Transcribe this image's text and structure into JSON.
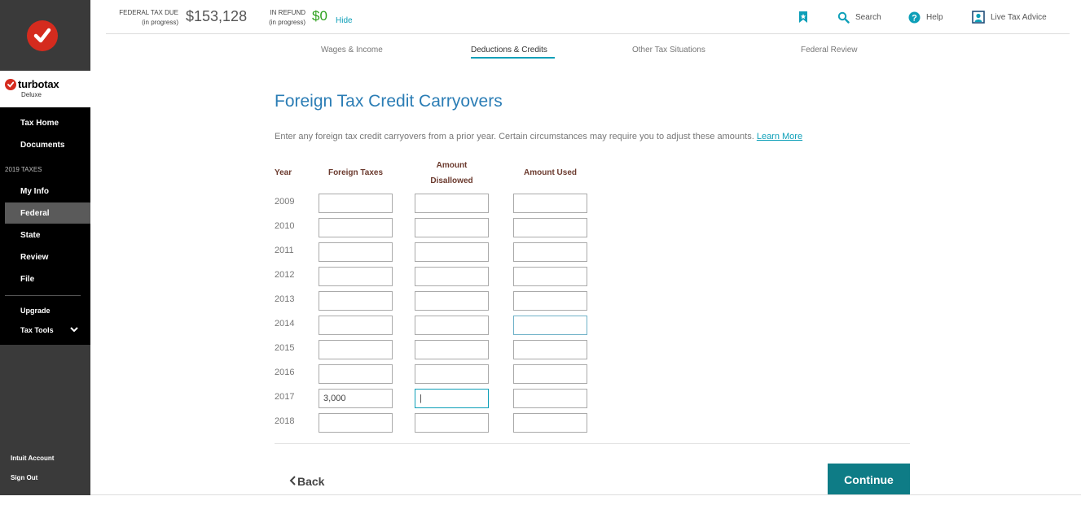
{
  "app": {
    "brand": "turbotax",
    "edition": "Deluxe"
  },
  "header": {
    "federal_label_1": "FEDERAL TAX DUE",
    "federal_label_2": "(in progress)",
    "federal_amount": "$153,128",
    "refund_label_1": "IN REFUND",
    "refund_label_2": "(in progress)",
    "refund_amount": "$0",
    "hide_label": "Hide",
    "search_label": "Search",
    "help_label": "Help",
    "live_label": "Live Tax Advice"
  },
  "sidebar": {
    "tax_home": "Tax Home",
    "documents": "Documents",
    "section_label": "2019 TAXES",
    "my_info": "My Info",
    "federal": "Federal",
    "state": "State",
    "review": "Review",
    "file": "File",
    "upgrade": "Upgrade",
    "tax_tools": "Tax Tools",
    "intuit_account": "Intuit Account",
    "sign_out": "Sign Out"
  },
  "tabs": [
    "Wages & Income",
    "Deductions & Credits",
    "Other Tax Situations",
    "Federal Review"
  ],
  "main": {
    "title": "Foreign Tax Credit Carryovers",
    "intro": "Enter any foreign tax credit carryovers from a prior year. Certain circumstances may require you to adjust these amounts.",
    "learn_more": "Learn More",
    "col_year": "Year",
    "col_foreign": "Foreign Taxes",
    "col_disallowed_1": "Amount",
    "col_disallowed_2": "Disallowed",
    "col_used": "Amount Used",
    "rows": [
      {
        "year": "2009",
        "foreign": "",
        "disallowed": "",
        "used": ""
      },
      {
        "year": "2010",
        "foreign": "",
        "disallowed": "",
        "used": ""
      },
      {
        "year": "2011",
        "foreign": "",
        "disallowed": "",
        "used": ""
      },
      {
        "year": "2012",
        "foreign": "",
        "disallowed": "",
        "used": ""
      },
      {
        "year": "2013",
        "foreign": "",
        "disallowed": "",
        "used": ""
      },
      {
        "year": "2014",
        "foreign": "",
        "disallowed": "",
        "used": ""
      },
      {
        "year": "2015",
        "foreign": "",
        "disallowed": "",
        "used": ""
      },
      {
        "year": "2016",
        "foreign": "",
        "disallowed": "",
        "used": ""
      },
      {
        "year": "2017",
        "foreign": "3,000",
        "disallowed": "|",
        "used": ""
      },
      {
        "year": "2018",
        "foreign": "",
        "disallowed": "",
        "used": ""
      }
    ],
    "back_label": "Back",
    "continue_label": "Continue"
  },
  "colors": {
    "accent": "#0d9fb8",
    "title": "#2b7db5",
    "continue": "#0e7c86",
    "brand_red": "#d52b1e"
  }
}
